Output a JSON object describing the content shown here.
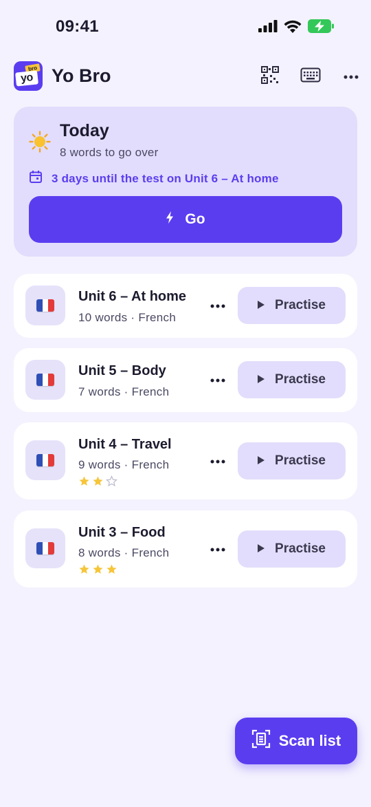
{
  "status_bar": {
    "time": "09:41",
    "icons": [
      "signal-icon",
      "wifi-icon",
      "battery-charging-icon"
    ]
  },
  "header": {
    "logo": {
      "top_text": "bro",
      "main_text": "yo"
    },
    "title": "Yo Bro",
    "actions": [
      "qr-code-icon",
      "keyboard-icon",
      "more-icon"
    ]
  },
  "today": {
    "title": "Today",
    "subtitle": "8 words to go over",
    "test_notice": "3 days until the test on Unit 6 – At home",
    "go_label": "Go"
  },
  "units": [
    {
      "name": "Unit 6 – At home",
      "meta": "10 words · French",
      "rating": null,
      "practise_label": "Practise"
    },
    {
      "name": "Unit 5 – Body",
      "meta": "7 words · French",
      "rating": null,
      "practise_label": "Practise"
    },
    {
      "name": "Unit 4 – Travel",
      "meta": "9 words · French",
      "rating": 2,
      "rating_max": 3,
      "practise_label": "Practise"
    },
    {
      "name": "Unit 3 – Food",
      "meta": "8 words · French",
      "rating": 3,
      "rating_max": 3,
      "practise_label": "Practise"
    }
  ],
  "scan_fab": {
    "label": "Scan list",
    "icon": "scan-document-icon"
  },
  "colors": {
    "background": "#f4f2fe",
    "accent": "#5b3df0",
    "card_tint": "#e2ddfc",
    "star": "#f6c53a",
    "battery": "#34c759"
  }
}
